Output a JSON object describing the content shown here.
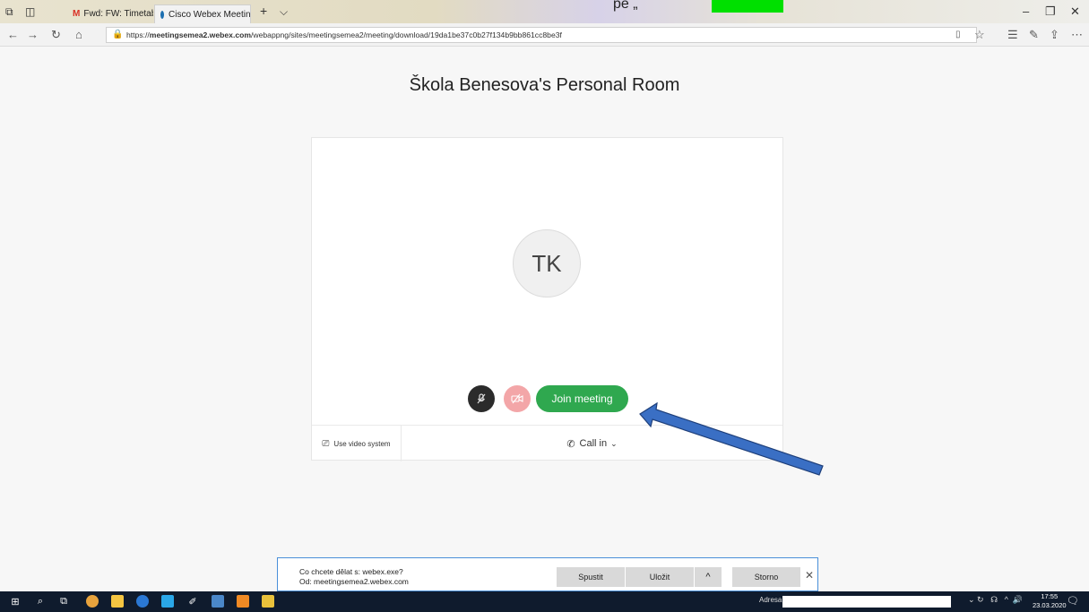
{
  "browser": {
    "tabs": [
      {
        "label": "Fwd: FW: Timetable - tobias",
        "icon": "gmail-icon"
      },
      {
        "label": "Cisco Webex Meetings '",
        "icon": "webex-icon"
      }
    ],
    "url_prefix": "https://",
    "url_domain": "meetingsemea2.webex.com",
    "url_path": "/webappng/sites/meetingsemea2/meeting/download/19da1be37c0b27f134b9bb861cc8be3f",
    "header_overlay_text": "pe „"
  },
  "page": {
    "title": "Škola Benesova's Personal Room",
    "avatar_initials": "TK",
    "join_button": "Join meeting",
    "use_video_system": "Use video system",
    "call_in": "Call in",
    "colors": {
      "join": "#2fa84f",
      "mute": "#2b2b2b",
      "video_off": "#f3a6a8",
      "arrow": "#3a6fc4"
    }
  },
  "download_prompt": {
    "question": "Co chcete dělat s: webex.exe?",
    "source": "Od: meetingsemea2.webex.com",
    "run": "Spustit",
    "save": "Uložit",
    "cancel": "Storno"
  },
  "taskbar": {
    "address_label": "Adresa",
    "time": "17:55",
    "date": "23.03.2020"
  }
}
